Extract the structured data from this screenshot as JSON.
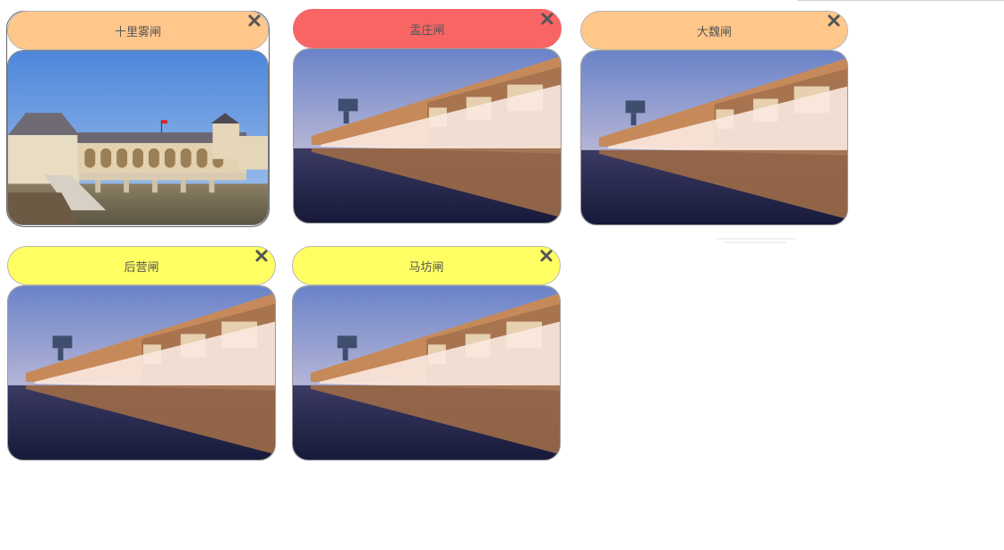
{
  "cards": [
    {
      "title": "十里雾闸",
      "header_color": "#ffc78a",
      "close_icon": "close-x-icon",
      "photo": "building-gate-photo"
    },
    {
      "title": "盂庄闸",
      "header_color": "#f96565",
      "close_icon": "close-x-icon",
      "photo": "dam-spillway-photo"
    },
    {
      "title": "大魏闸",
      "header_color": "#ffc78a",
      "close_icon": "close-x-icon",
      "photo": "dam-spillway-photo"
    },
    {
      "title": "后营闸",
      "header_color": "#ffff63",
      "close_icon": "close-x-icon",
      "photo": "dam-spillway-photo"
    },
    {
      "title": "马坊闸",
      "header_color": "#ffff63",
      "close_icon": "close-x-icon",
      "photo": "dam-spillway-photo"
    }
  ]
}
